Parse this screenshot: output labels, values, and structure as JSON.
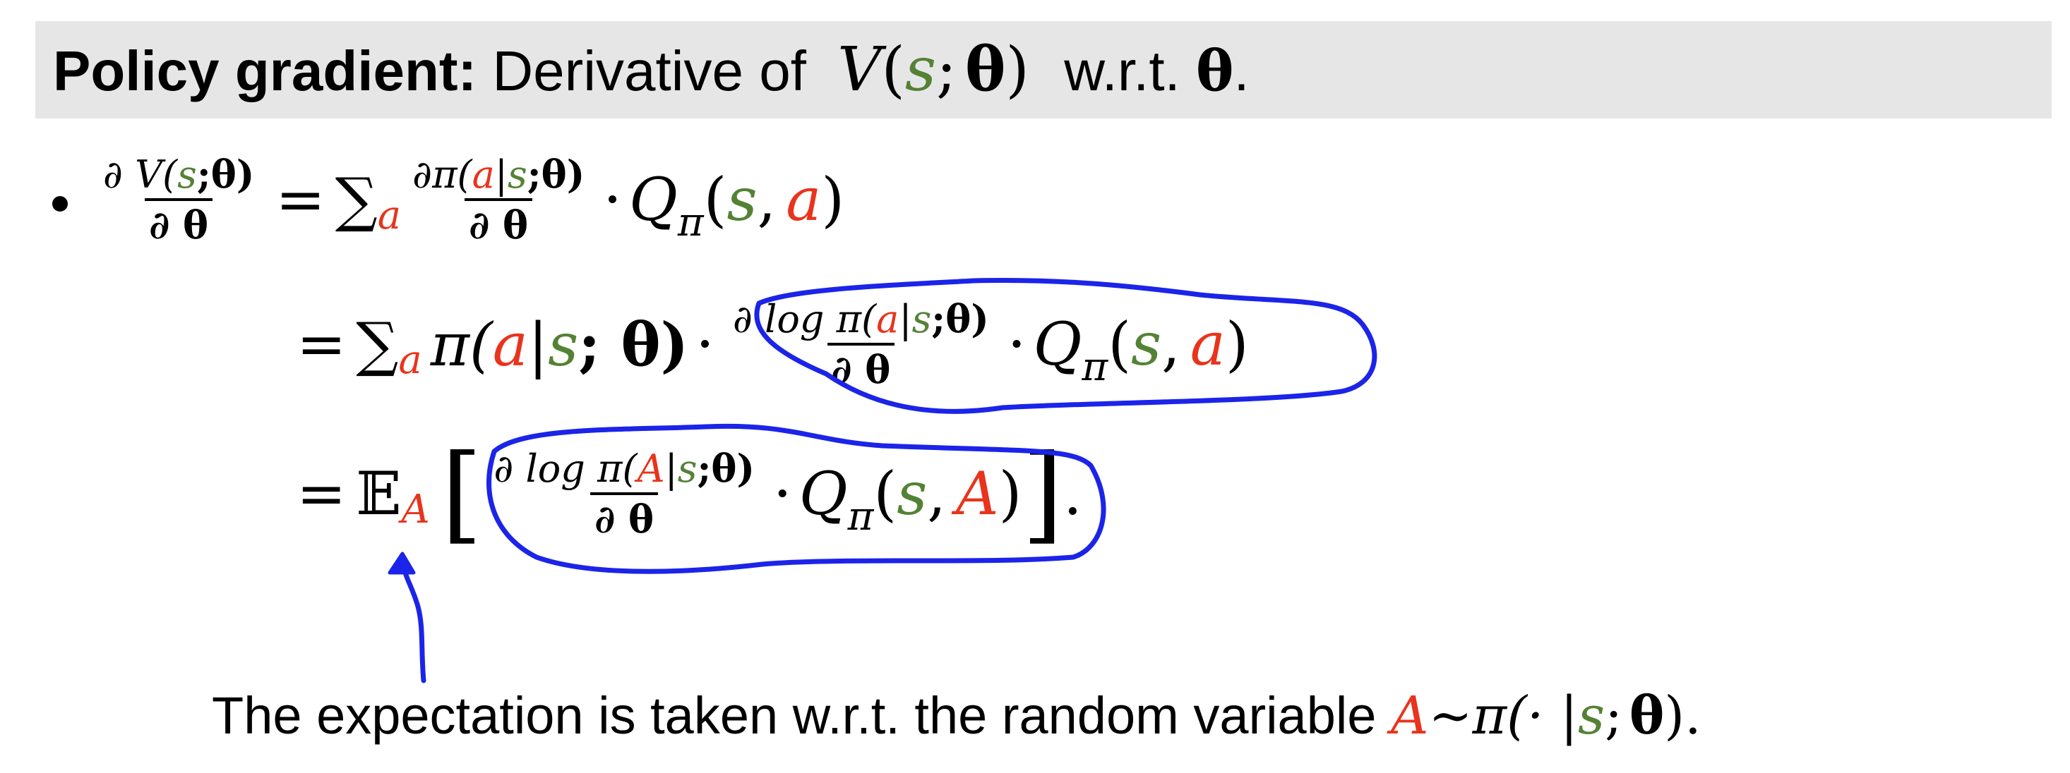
{
  "title": {
    "bold_text": "Policy gradient:",
    "text": "Derivative of",
    "func": "V",
    "paren_open": "(",
    "state": "s",
    "semi": ";",
    "theta": "θ",
    "paren_close": ")",
    "wrt": "w.r.t.",
    "theta2": "θ",
    "period": "."
  },
  "equations": {
    "line1": {
      "lhs_num": "∂ V(",
      "lhs_num_s": "s",
      "lhs_num_rest": ";θ)",
      "lhs_den": "∂ θ",
      "eq": "=",
      "sum": "∑",
      "sum_sub": "a",
      "frac_num_a": "∂π(",
      "frac_num_action": "a",
      "frac_num_bar": "|",
      "frac_num_state": "s",
      "frac_num_rest": ";θ)",
      "frac_den": "∂ θ",
      "dot": "·",
      "q": "Q",
      "q_sub": "π",
      "q_open": "(",
      "q_s": "s",
      "q_comma": ",",
      "q_a": "a",
      "q_close": ")"
    },
    "line2": {
      "eq": "=",
      "sum": "∑",
      "sum_sub": "a",
      "pi": "π(",
      "pi_a": "a",
      "pi_bar": "|",
      "pi_s": "s",
      "pi_rest": "; θ)",
      "dot": "·",
      "frac_num_a": "∂ log π(",
      "frac_num_action": "a",
      "frac_num_bar": "|",
      "frac_num_state": "s",
      "frac_num_rest": ";θ)",
      "frac_den": "∂ θ",
      "dot2": "·",
      "q": "Q",
      "q_sub": "π",
      "q_open": "(",
      "q_s": "s",
      "q_comma": ",",
      "q_a": "a",
      "q_close": ")"
    },
    "line3": {
      "eq": "=",
      "expect": "𝔼",
      "expect_sub": "A",
      "lbr": "[",
      "frac_num_a": "∂ log π(",
      "frac_num_action": "A",
      "frac_num_bar": "|",
      "frac_num_state": "s",
      "frac_num_rest": ";θ)",
      "frac_den": "∂ θ",
      "dot": "·",
      "q": "Q",
      "q_sub": "π",
      "q_open": "(",
      "q_s": "s",
      "q_comma": ",",
      "q_a": "A",
      "q_close": ")",
      "rbr": "]",
      "period": "."
    }
  },
  "caption": {
    "text": "The expectation is taken w.r.t. the random variable",
    "rv": "A",
    "tilde": "∼π(· |",
    "state": "s",
    "rest_semi": ";",
    "theta": "θ",
    "rest_close": ")."
  },
  "colors": {
    "state_green": "#548235",
    "action_red": "#e8341c",
    "annotation_blue": "#1b24e8",
    "title_bar_gray": "#e7e6e6"
  }
}
